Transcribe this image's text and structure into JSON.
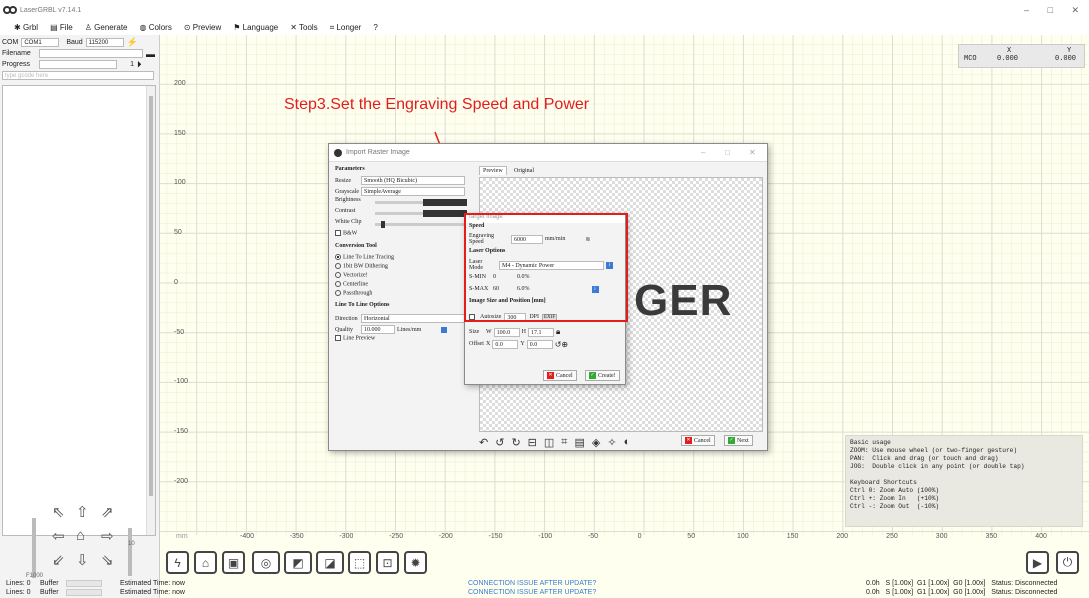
{
  "app": {
    "title": "LaserGRBL v7.14.1",
    "min_glyph": "–",
    "max_glyph": "□",
    "close_glyph": "✕"
  },
  "menu": [
    "Grbl",
    "File",
    "Generate",
    "Colors",
    "Preview",
    "Language",
    "Tools",
    "Longer",
    "?"
  ],
  "left": {
    "com_label": "COM",
    "com_value": "COM1",
    "baud_label": "Baud",
    "baud_value": "115200",
    "filename_label": "Filename",
    "progress_label": "Progress",
    "progress_value": "1",
    "gcode_placeholder": "type gcode here",
    "speed_label": "F1000",
    "step_label": "10"
  },
  "canvas": {
    "y_ticks": [
      "200",
      "150",
      "100",
      "50",
      "0",
      "-50",
      "-100",
      "-150",
      "-200"
    ],
    "x_ticks": [
      "-400",
      "-350",
      "-300",
      "-250",
      "-200",
      "-150",
      "-100",
      "-50",
      "0",
      "50",
      "100",
      "150",
      "200",
      "250",
      "300",
      "350",
      "400"
    ],
    "x_axis_unit": "mm",
    "step_title": "Step3.Set the Engraving Speed and Power",
    "coords": {
      "mco_label": "MCO",
      "x_label": "X",
      "y_label": "Y",
      "x": "0.000",
      "y": "0.000"
    },
    "help_lines": [
      "Basic usage",
      "ZOOM: Use mouse wheel (or two-finger gesture)",
      "PAN:  Click and drag (or touch and drag)",
      "JOG:  Double click in any point (or double tap)",
      "",
      "Keyboard Shortcuts",
      "Ctrl 0: Zoom Auto (100%)",
      "Ctrl +: Zoom In   (+10%)",
      "Ctrl -: Zoom Out  (-10%)"
    ]
  },
  "import_dialog": {
    "title": "Import Raster Image",
    "parameters_header": "Parameters",
    "resize_label": "Resize",
    "resize_value": "Smooth (HQ Bicubic)",
    "grayscale_label": "Grayscale",
    "grayscale_value": "SimpleAverage",
    "brightness_label": "Brightness",
    "contrast_label": "Contrast",
    "whiteclip_label": "White Clip",
    "bw_label": "B&W",
    "conversion_header": "Conversion Tool",
    "tools": [
      "Line To Line Tracing",
      "1bit BW Dithering",
      "Vectorize!",
      "Centerline",
      "Passthrough"
    ],
    "ltl_header": "Line To Line Options",
    "direction_label": "Direction",
    "direction_value": "Horizontal",
    "quality_label": "Quality",
    "quality_value": "10.000",
    "quality_unit": "Lines/mm",
    "line_preview_label": "Line Preview",
    "tab_preview": "Preview",
    "tab_original": "Original",
    "preview_text": "GER",
    "cancel_label": "Cancel",
    "next_label": "Next"
  },
  "target_dialog": {
    "title": "Target image",
    "speed_header": "Speed",
    "engraving_speed_label": "Engraving Speed",
    "engraving_speed_value": "6000",
    "speed_unit": "mm/min",
    "laser_header": "Laser Options",
    "laser_mode_label": "Laser Mode",
    "laser_mode_value": "M4 - Dynamic Power",
    "smin_label": "S-MIN",
    "smin_value": "0",
    "smin_pct": "0.0%",
    "smax_label": "S-MAX",
    "smax_value": "60",
    "smax_pct": "6.0%",
    "size_header": "Image Size and Position [mm]",
    "autosize_label": "Autosize",
    "autosize_value": "300",
    "dpi_label": "DPI",
    "exif_label": "EXIF",
    "size_label": "Size",
    "w_label": "W",
    "w_value": "100.0",
    "h_label": "H",
    "h_value": "17.1",
    "offset_label": "Offset",
    "x_label": "X",
    "x_value": "0.0",
    "y_label": "Y",
    "y_value": "0.0",
    "cancel_label": "Cancel",
    "create_label": "Create!"
  },
  "status": {
    "line1_lines": "Lines: 0",
    "line1_buffer": "Buffer",
    "line1_time": "Estimated Time: now",
    "line2_lines": "Lines: 0",
    "line2_buffer": "Buffer",
    "line2_time": "Estimated Time: now",
    "conn1": "CONNECTION ISSUE AFTER UPDATE?",
    "conn2": "CONNECTION ISSUE AFTER UPDATE?",
    "right1": "0.0h   S [1.00x]  G1 [1.00x]  G0 [1.00x]   Status: Disconnected",
    "right2": "0.0h   S [1.00x]  G1 [1.00x]  G0 [1.00x]   Status: Disconnected"
  },
  "colors": {
    "accent_red": "#e31d1c",
    "link_blue": "#3b7bd6",
    "grid": "#e3e3c8",
    "step_text": "#e31d1c"
  }
}
